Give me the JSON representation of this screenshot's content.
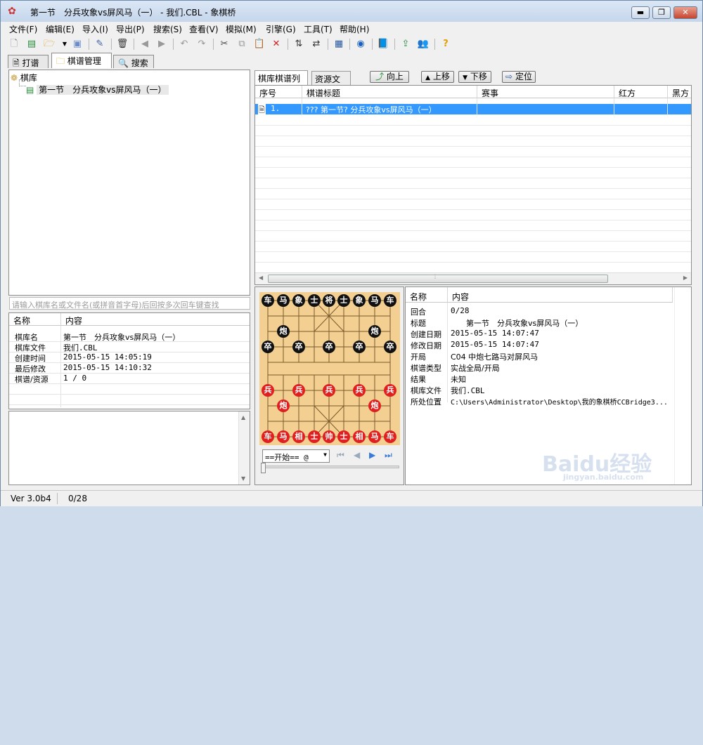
{
  "window": {
    "title": "第一节　分兵攻象vs屏风马（一） - 我们.CBL - 象棋桥",
    "min": "▬",
    "max": "❐",
    "close": "✕"
  },
  "menu": [
    "文件(F)",
    "编辑(E)",
    "导入(I)",
    "导出(P)",
    "搜索(S)",
    "查看(V)",
    "模拟(M)",
    "引擎(G)",
    "工具(T)",
    "帮助(H)"
  ],
  "top_tabs": [
    "打谱",
    "棋谱管理",
    "搜索"
  ],
  "tree": {
    "root": "棋库",
    "child": "第一节　分兵攻象vs屏风马（一）"
  },
  "search_hint": "请输入棋库名或文件名(或拼音首字母)后回按多次回车键查找",
  "lib_info": {
    "headers": [
      "名称",
      "内容"
    ],
    "rows": [
      [
        "棋库名",
        "第一节　分兵攻象vs屏风马（一）"
      ],
      [
        "棋库文件",
        "我们.CBL"
      ],
      [
        "创建时间",
        "2015-05-15 14:05:19"
      ],
      [
        "最后修改",
        "2015-05-15 14:10:32"
      ],
      [
        "棋谱/资源",
        "1 / 0"
      ]
    ]
  },
  "subtabs": [
    "棋库棋谱列表",
    "资源文件"
  ],
  "buttons": {
    "up_dir": "向上",
    "move_up": "上移",
    "move_down": "下移",
    "locate": "定位"
  },
  "game_list": {
    "headers": [
      "序号",
      "棋谱标题",
      "赛事",
      "红方",
      "黑方"
    ],
    "rows": [
      [
        "1.",
        "??? 第一节? 分兵攻象vs屏风马（一）",
        "",
        "",
        ""
      ]
    ]
  },
  "board": {
    "black": [
      [
        "车",
        "马",
        "象",
        "士",
        "将",
        "士",
        "象",
        "马",
        "车"
      ]
    ],
    "black_cannon": "炮",
    "black_pawn": "卒",
    "red": [
      "车",
      "马",
      "相",
      "士",
      "帅",
      "士",
      "相",
      "马",
      "车"
    ],
    "red_cannon": "炮",
    "red_pawn": "兵"
  },
  "move_select": "==开始== @",
  "game_info": {
    "headers": [
      "名称",
      "内容"
    ],
    "rows": [
      [
        "回合",
        "0/28"
      ],
      [
        "标题",
        "　　第一节　分兵攻象vs屏风马（一）"
      ],
      [
        "创建日期",
        "2015-05-15 14:07:47"
      ],
      [
        "修改日期",
        "2015-05-15 14:07:47"
      ],
      [
        "开局",
        "C04 中炮七路马对屏风马"
      ],
      [
        "棋谱类型",
        "实战全局/开局"
      ],
      [
        "结果",
        "未知"
      ],
      [
        "棋库文件",
        "我们.CBL"
      ],
      [
        "所处位置",
        "C:\\Users\\Administrator\\Desktop\\我的象棋桥CCBridge3..."
      ]
    ]
  },
  "status": {
    "version": "Ver 3.0b4",
    "moves": "0/28"
  },
  "watermark": {
    "logo": "Baidu经验",
    "url": "jingyan.baidu.com"
  }
}
